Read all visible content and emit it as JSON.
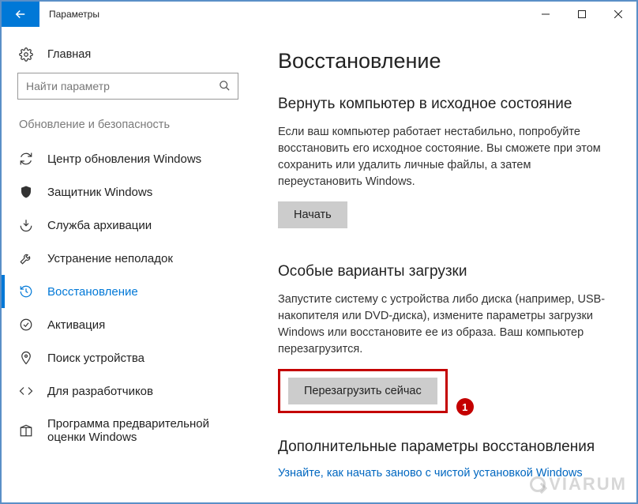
{
  "window": {
    "title": "Параметры"
  },
  "sidebar": {
    "home": "Главная",
    "search_placeholder": "Найти параметр",
    "section_header": "Обновление и безопасность",
    "items": [
      {
        "label": "Центр обновления Windows"
      },
      {
        "label": "Защитник Windows"
      },
      {
        "label": "Служба архивации"
      },
      {
        "label": "Устранение неполадок"
      },
      {
        "label": "Восстановление"
      },
      {
        "label": "Активация"
      },
      {
        "label": "Поиск устройства"
      },
      {
        "label": "Для разработчиков"
      },
      {
        "label": "Программа предварительной оценки Windows"
      }
    ],
    "active_index": 4
  },
  "main": {
    "page_title": "Восстановление",
    "sections": [
      {
        "heading": "Вернуть компьютер в исходное состояние",
        "body": "Если ваш компьютер работает нестабильно, попробуйте восстановить его исходное состояние. Вы сможете при этом сохранить или удалить личные файлы, а затем переустановить Windows.",
        "button": "Начать"
      },
      {
        "heading": "Особые варианты загрузки",
        "body": "Запустите систему с устройства либо диска (например, USB-накопителя или DVD-диска), измените параметры загрузки Windows или восстановите ее из образа. Ваш компьютер перезагрузится.",
        "button": "Перезагрузить сейчас"
      },
      {
        "heading": "Дополнительные параметры восстановления",
        "link": "Узнайте, как начать заново с чистой установкой Windows"
      }
    ]
  },
  "annotation": {
    "badge": "1"
  },
  "watermark": "VIARUM"
}
